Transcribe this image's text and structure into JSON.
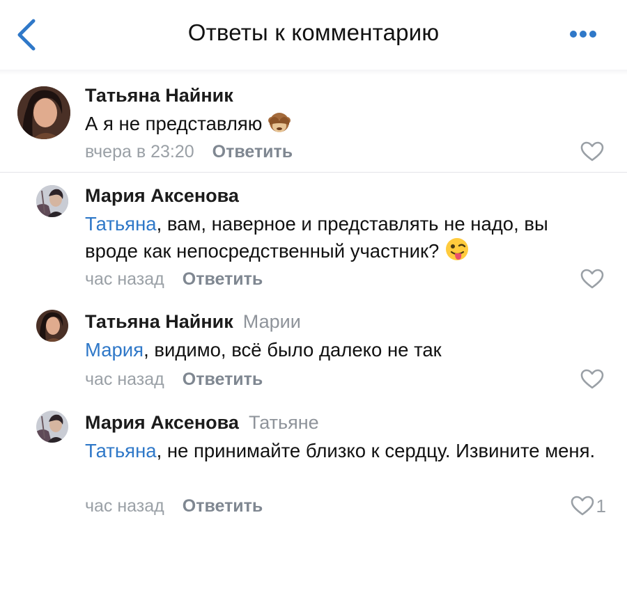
{
  "header": {
    "title": "Ответы к комментарию",
    "back_icon": "chevron-left-icon",
    "more_icon": "more-horizontal-icon"
  },
  "colors": {
    "accent": "#2f78c8",
    "secondary_text": "#9aa0a6",
    "divider": "#e3e4e8"
  },
  "comments": [
    {
      "author": "Татьяна Найник",
      "reply_to": "",
      "mention": "",
      "text": "А я не представляю",
      "emoji": "see-no-evil-monkey-icon",
      "time": "вчера в 23:20",
      "reply_label": "Ответить",
      "likes": ""
    },
    {
      "author": "Мария Аксенова",
      "reply_to": "",
      "mention": "Татьяна",
      "text": ", вам, наверное и представлять не надо, вы вроде как непосредственный участник?",
      "emoji": "winking-tongue-face-icon",
      "time": "час назад",
      "reply_label": "Ответить",
      "likes": ""
    },
    {
      "author": "Татьяна Найник",
      "reply_to": "Марии",
      "mention": "Мария",
      "text": ", видимо, всё было далеко не так",
      "emoji": "",
      "time": "час назад",
      "reply_label": "Ответить",
      "likes": ""
    },
    {
      "author": "Мария Аксенова",
      "reply_to": "Татьяне",
      "mention": "Татьяна",
      "text": ", не принимайте близко к сердцу. Извините меня.",
      "emoji": "",
      "time": "час назад",
      "reply_label": "Ответить",
      "likes": "1"
    }
  ]
}
